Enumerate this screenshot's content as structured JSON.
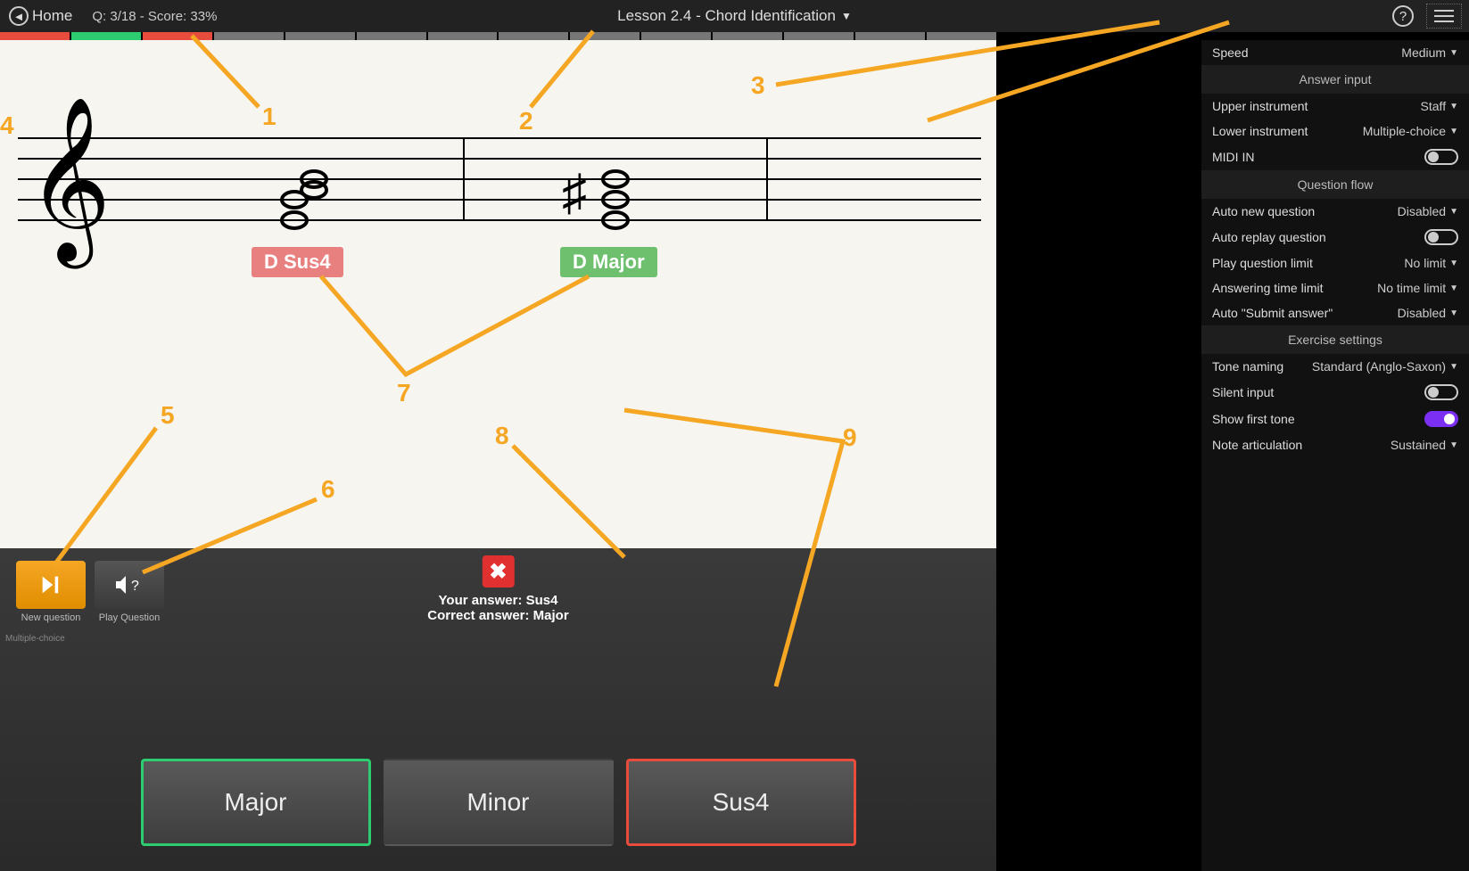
{
  "header": {
    "home": "Home",
    "qscore": "Q: 3/18 - Score: 33%",
    "lesson": "Lesson 2.4 - Chord Identification"
  },
  "progress_segments": [
    "red",
    "green",
    "redl",
    "grey",
    "grey",
    "grey",
    "grey",
    "grey",
    "grey",
    "grey",
    "grey",
    "grey",
    "grey",
    "grey"
  ],
  "chords": {
    "left_label": "D Sus4",
    "right_label": "D Major"
  },
  "controls": {
    "new_question": "New question",
    "play_question": "Play Question",
    "multiple_choice": "Multiple-choice"
  },
  "result": {
    "your_answer_prefix": "Your answer: ",
    "your_answer": "Sus4",
    "correct_answer_prefix": "Correct answer: ",
    "correct_answer": "Major"
  },
  "answers": [
    "Major",
    "Minor",
    "Sus4"
  ],
  "annotations": [
    "1",
    "2",
    "3",
    "4",
    "5",
    "6",
    "7",
    "8",
    "9"
  ],
  "side": {
    "speed": {
      "label": "Speed",
      "value": "Medium"
    },
    "answer_input_head": "Answer input",
    "upper": {
      "label": "Upper instrument",
      "value": "Staff"
    },
    "lower": {
      "label": "Lower instrument",
      "value": "Multiple-choice"
    },
    "midi": {
      "label": "MIDI IN"
    },
    "question_flow_head": "Question flow",
    "auto_new": {
      "label": "Auto new question",
      "value": "Disabled"
    },
    "auto_replay": {
      "label": "Auto replay question"
    },
    "play_limit": {
      "label": "Play question limit",
      "value": "No limit"
    },
    "ans_time": {
      "label": "Answering time limit",
      "value": "No time limit"
    },
    "auto_submit": {
      "label": "Auto \"Submit answer\"",
      "value": "Disabled"
    },
    "exercise_head": "Exercise settings",
    "tone_naming": {
      "label": "Tone naming",
      "value": "Standard (Anglo-Saxon)"
    },
    "silent": {
      "label": "Silent input"
    },
    "show_first": {
      "label": "Show first tone"
    },
    "articulation": {
      "label": "Note articulation",
      "value": "Sustained"
    }
  }
}
